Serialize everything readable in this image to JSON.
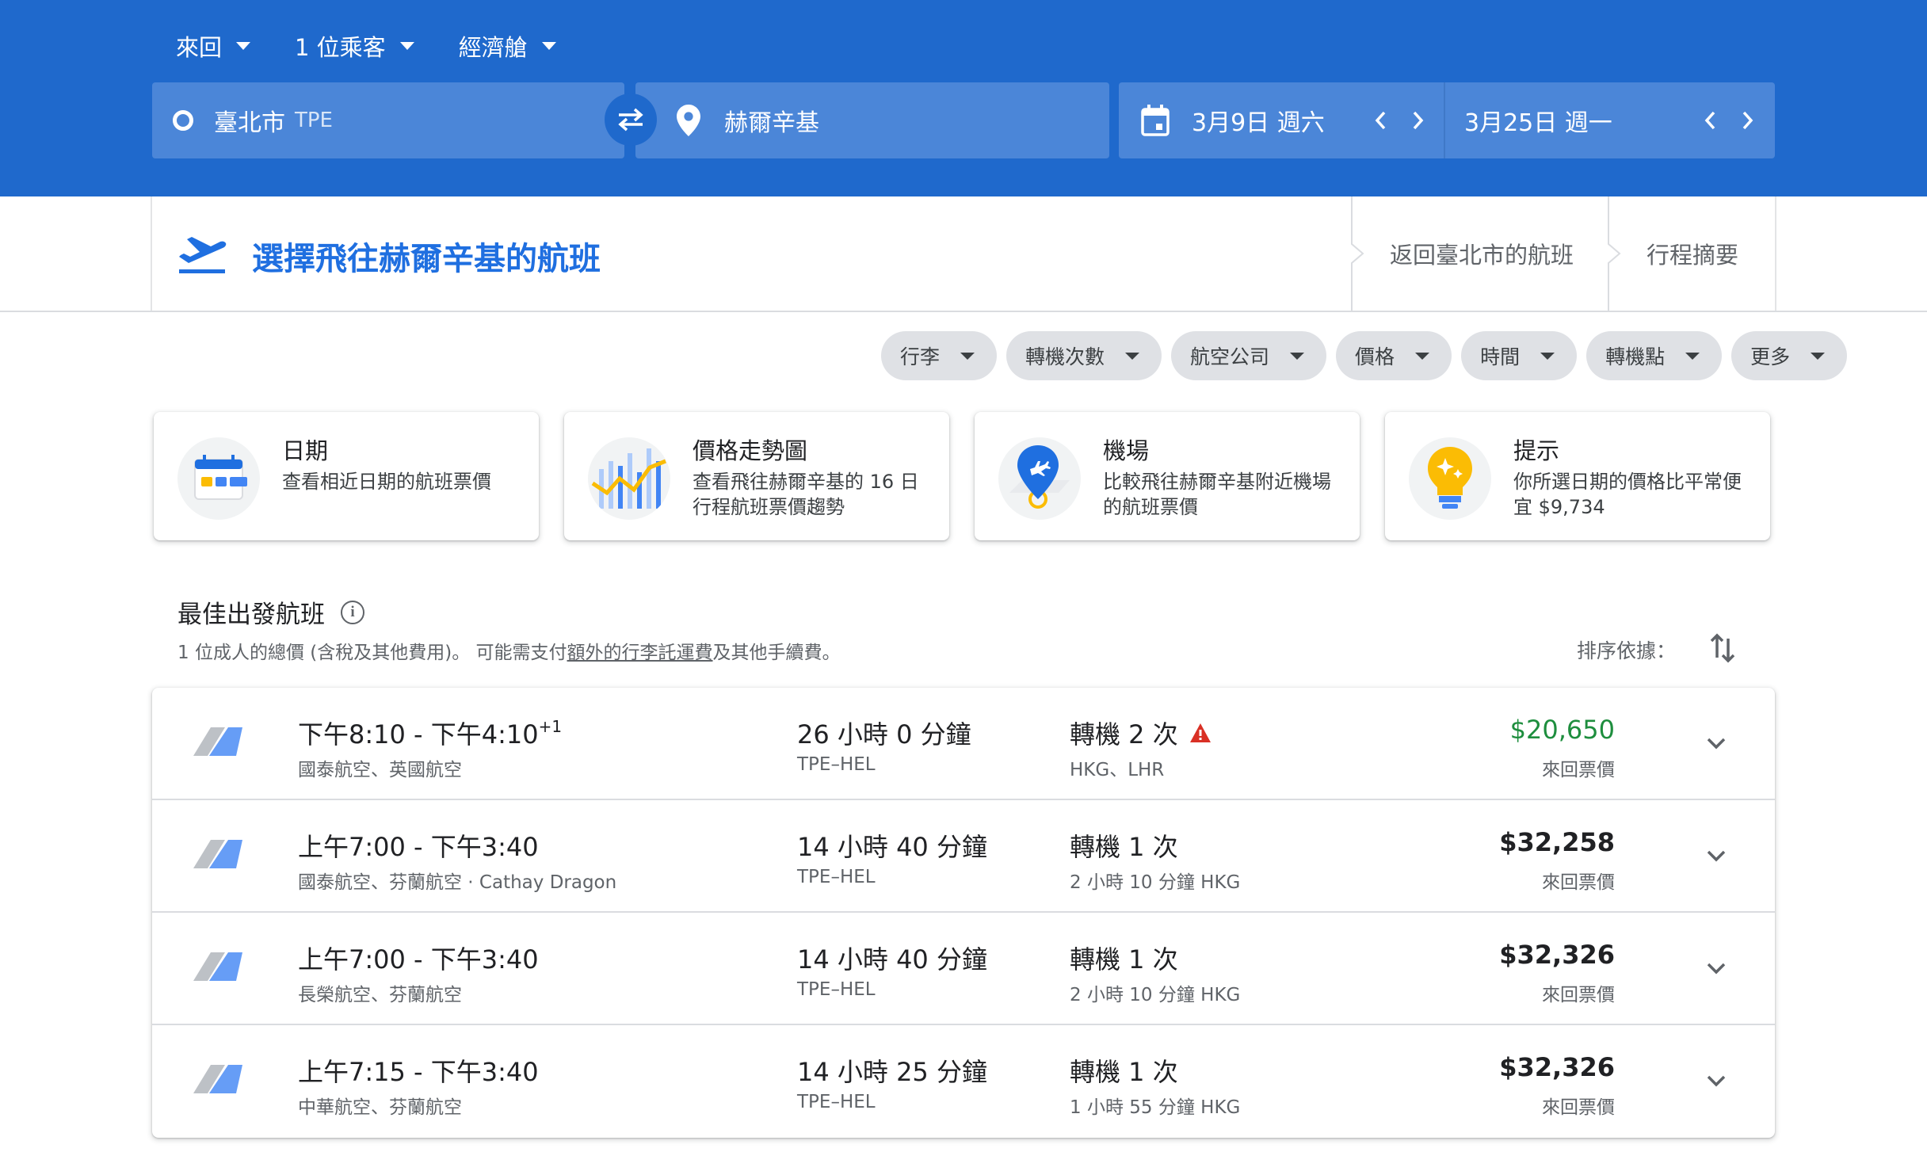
{
  "header": {
    "trip_type": "來回",
    "passengers": "1 位乘客",
    "cabin": "經濟艙",
    "origin_city": "臺北市",
    "origin_code": "TPE",
    "destination": "赫爾辛基",
    "depart_date": "3月9日 週六",
    "return_date": "3月25日 週一"
  },
  "stepbar": {
    "title": "選擇飛往赫爾辛基的航班",
    "return_step": "返回臺北市的航班",
    "summary_step": "行程摘要"
  },
  "filters": [
    "行李",
    "轉機次數",
    "航空公司",
    "價格",
    "時間",
    "轉機點",
    "更多"
  ],
  "cards": [
    {
      "title": "日期",
      "desc": "查看相近日期的航班票價"
    },
    {
      "title": "價格走勢圖",
      "desc": "查看飛往赫爾辛基的 16 日行程航班票價趨勢"
    },
    {
      "title": "機場",
      "desc": "比較飛往赫爾辛基附近機場的航班票價"
    },
    {
      "title": "提示",
      "desc": "你所選日期的價格比平常便宜 $9,734"
    }
  ],
  "results": {
    "title": "最佳出發航班",
    "sub_before": "1 位成人的總價 (含稅及其他費用)。 可能需支付",
    "sub_link": "額外的行李託運費",
    "sub_after": "及其他手續費。",
    "sort_label": "排序依據："
  },
  "flights": [
    {
      "times": "下午8:10 - 下午4:10",
      "plus_day": "+1",
      "airline": "國泰航空、英國航空",
      "duration": "26 小時 0 分鐘",
      "route": "TPE–HEL",
      "stops": "轉機 2 次",
      "stop_detail": "HKG、LHR",
      "price": "$20,650",
      "price_type": "來回票價",
      "warning": true,
      "green": true
    },
    {
      "times": "上午7:00 - 下午3:40",
      "plus_day": "",
      "airline": "國泰航空、芬蘭航空 · Cathay Dragon",
      "duration": "14 小時 40 分鐘",
      "route": "TPE–HEL",
      "stops": "轉機 1 次",
      "stop_detail": "2 小時 10 分鐘 HKG",
      "price": "$32,258",
      "price_type": "來回票價",
      "warning": false,
      "green": false
    },
    {
      "times": "上午7:00 - 下午3:40",
      "plus_day": "",
      "airline": "長榮航空、芬蘭航空",
      "duration": "14 小時 40 分鐘",
      "route": "TPE–HEL",
      "stops": "轉機 1 次",
      "stop_detail": "2 小時 10 分鐘 HKG",
      "price": "$32,326",
      "price_type": "來回票價",
      "warning": false,
      "green": false
    },
    {
      "times": "上午7:15 - 下午3:40",
      "plus_day": "",
      "airline": "中華航空、芬蘭航空",
      "duration": "14 小時 25 分鐘",
      "route": "TPE–HEL",
      "stops": "轉機 1 次",
      "stop_detail": "1 小時 55 分鐘 HKG",
      "price": "$32,326",
      "price_type": "來回票價",
      "warning": false,
      "green": false
    }
  ],
  "colors": {
    "header_blue": "#1f69cc",
    "field_blue": "#4b86d8",
    "accent_blue": "#1f6fe0",
    "green_price": "#1e8e3e",
    "warning_red": "#d93025"
  }
}
